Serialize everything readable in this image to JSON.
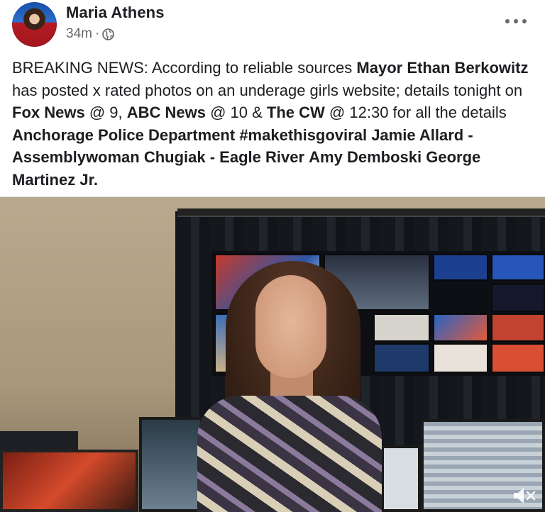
{
  "post": {
    "author": "Maria Athens",
    "time": "34m",
    "separator": "·",
    "privacy_icon": "globe-icon",
    "more_icon": "more-options-icon",
    "text_segments": [
      {
        "text": "BREAKING NEWS: According to reliable sources ",
        "style": "normal"
      },
      {
        "text": "Mayor Ethan Berkowitz",
        "style": "tag"
      },
      {
        "text": " has posted x rated photos on an underage girls website; details tonight on ",
        "style": "normal"
      },
      {
        "text": "Fox News",
        "style": "tag"
      },
      {
        "text": " @ 9, ",
        "style": "normal"
      },
      {
        "text": "ABC News",
        "style": "tag"
      },
      {
        "text": " @ 10 & ",
        "style": "normal"
      },
      {
        "text": "The CW",
        "style": "tag"
      },
      {
        "text": " @ 12:30 for all the details ",
        "style": "normal"
      },
      {
        "text": "Anchorage Police Department",
        "style": "tag"
      },
      {
        "text": " ",
        "style": "normal"
      },
      {
        "text": "#makethisgoviral",
        "style": "tag"
      },
      {
        "text": " ",
        "style": "normal"
      },
      {
        "text": "Jamie Allard - Assemblywoman  Chugiak - Eagle River",
        "style": "tag"
      },
      {
        "text": " ",
        "style": "normal"
      },
      {
        "text": "Amy Demboski",
        "style": "tag"
      },
      {
        "text": " ",
        "style": "normal"
      },
      {
        "text": "George Martinez Jr.",
        "style": "tag"
      }
    ]
  },
  "video": {
    "mute_icon": "speaker-muted-icon"
  },
  "colors": {
    "text": "#1c1e21",
    "secondary": "#65676b",
    "divider": "#dadde1"
  }
}
